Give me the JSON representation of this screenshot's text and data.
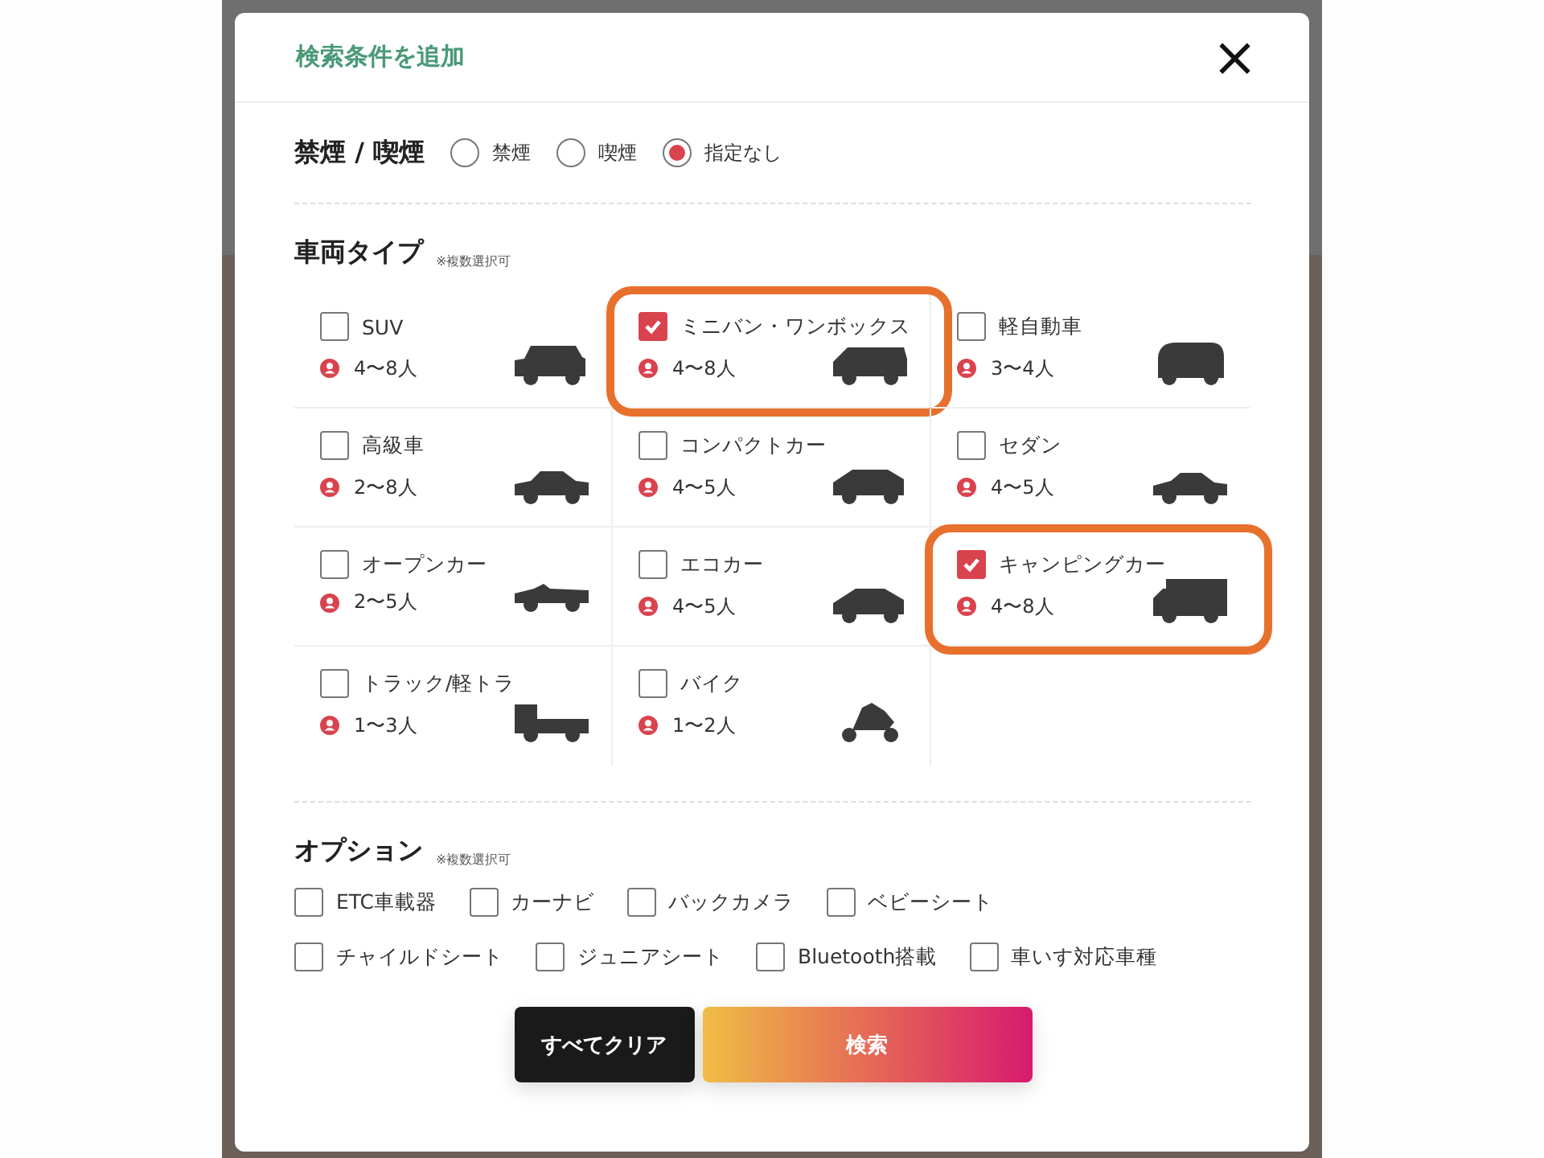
{
  "dialog": {
    "title": "検索条件を追加",
    "close": "×"
  },
  "smoking": {
    "label": "禁煙 / 喫煙",
    "options": [
      {
        "label": "禁煙",
        "selected": false
      },
      {
        "label": "喫煙",
        "selected": false
      },
      {
        "label": "指定なし",
        "selected": true
      }
    ]
  },
  "vehicle_types": {
    "label": "車両タイプ",
    "note": "※複数選択可",
    "items": [
      {
        "name": "SUV",
        "capacity": "4〜8人",
        "checked": false,
        "highlighted": false,
        "kind": "suv"
      },
      {
        "name": "ミニバン・ワンボックス",
        "capacity": "4〜8人",
        "checked": true,
        "highlighted": true,
        "kind": "minivan"
      },
      {
        "name": "軽自動車",
        "capacity": "3〜4人",
        "checked": false,
        "highlighted": false,
        "kind": "kei"
      },
      {
        "name": "高級車",
        "capacity": "2〜8人",
        "checked": false,
        "highlighted": false,
        "kind": "luxury"
      },
      {
        "name": "コンパクトカー",
        "capacity": "4〜5人",
        "checked": false,
        "highlighted": false,
        "kind": "compact"
      },
      {
        "name": "セダン",
        "capacity": "4〜5人",
        "checked": false,
        "highlighted": false,
        "kind": "sedan"
      },
      {
        "name": "オープンカー",
        "capacity": "2〜5人",
        "checked": false,
        "highlighted": false,
        "kind": "open"
      },
      {
        "name": "エコカー",
        "capacity": "4〜5人",
        "checked": false,
        "highlighted": false,
        "kind": "eco"
      },
      {
        "name": "キャンピングカー",
        "capacity": "4〜8人",
        "checked": true,
        "highlighted": true,
        "kind": "camper"
      },
      {
        "name": "トラック/軽トラ",
        "capacity": "1〜3人",
        "checked": false,
        "highlighted": false,
        "kind": "truck"
      },
      {
        "name": "バイク",
        "capacity": "1〜2人",
        "checked": false,
        "highlighted": false,
        "kind": "bike"
      }
    ]
  },
  "options": {
    "label": "オプション",
    "note": "※複数選択可",
    "rows": [
      [
        {
          "label": "ETC車載器",
          "checked": false
        },
        {
          "label": "カーナビ",
          "checked": false
        },
        {
          "label": "バックカメラ",
          "checked": false
        },
        {
          "label": "ベビーシート",
          "checked": false
        }
      ],
      [
        {
          "label": "チャイルドシート",
          "checked": false
        },
        {
          "label": "ジュニアシート",
          "checked": false
        },
        {
          "label": "Bluetooth搭載",
          "checked": false
        },
        {
          "label": "車いす対応車種",
          "checked": false
        }
      ]
    ]
  },
  "buttons": [
    {
      "label": "すべてクリア",
      "kind": "secondary"
    },
    {
      "label": "検索",
      "kind": "primary"
    }
  ]
}
